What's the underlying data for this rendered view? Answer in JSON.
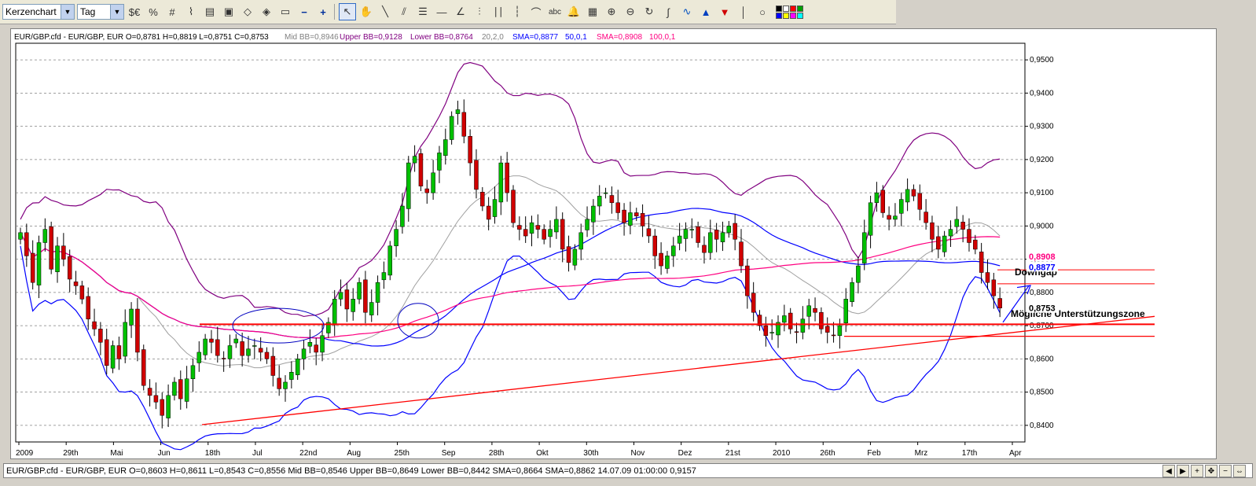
{
  "toolbar": {
    "chart_type": "Kerzenchart",
    "interval": "Tag",
    "tools": [
      "cursor",
      "hand",
      "line",
      "parallel-lines",
      "fibonacci",
      "horizontal-line",
      "fan",
      "channel",
      "cycles",
      "arc",
      "text",
      "bell",
      "calculator",
      "zoom-in",
      "zoom-out",
      "rotate",
      "wave",
      "arrow-up",
      "arrow-down",
      "vertical-line",
      "circle"
    ],
    "palette": [
      "#000000",
      "#ffffff",
      "#ff0000",
      "#00a000",
      "#0000ff",
      "#ffff00",
      "#ff00ff",
      "#00ffff"
    ]
  },
  "header": {
    "symbol": "EUR/GBP.cfd - EUR/GBP, EUR O=0,8781 H=0,8819 L=0,8751 C=0,8753",
    "mid_bb": "Mid BB=0,8946",
    "upper_bb": "Upper BB=0,9128",
    "lower_bb": "Lower BB=0,8764",
    "bb_params": "20,2,0",
    "sma50": "SMA=0,8877",
    "sma50_params": "50,0,1",
    "sma100": "SMA=0,8908",
    "sma100_params": "100,0,1"
  },
  "status": {
    "text": "EUR/GBP.cfd - EUR/GBP, EUR O=0,8603 H=0,8611 L=0,8543 C=0,8556 Mid BB=0,8546 Upper BB=0,8649 Lower BB=0,8442 SMA=0,8664 SMA=0,8862  14.07.09 01:00:00 0,9157"
  },
  "annotations": {
    "downgap": "Downgap",
    "support": "Mögliche Unterstützungszone"
  },
  "colors": {
    "bull": "#00c000",
    "bear": "#d00000",
    "bb": "#800080",
    "bb_mid": "#a0a0a0",
    "sma50": "#0000ff",
    "sma100": "#ff0080",
    "trend": "#ff0000"
  },
  "chart_data": {
    "type": "candlestick",
    "ylim": [
      0.835,
      0.955
    ],
    "yticks": [
      "0,9500",
      "0,9400",
      "0,9300",
      "0,9200",
      "0,9100",
      "0,9000",
      "0,8900",
      "0,8800",
      "0,8700",
      "0,8600",
      "0,8500",
      "0,8400"
    ],
    "xticks": [
      "2009",
      "29th",
      "Mai",
      "Jun",
      "18th",
      "Jul",
      "22nd",
      "Aug",
      "25th",
      "Sep",
      "28th",
      "Okt",
      "30th",
      "Nov",
      "Dez",
      "21st",
      "2010",
      "26th",
      "Feb",
      "Mrz",
      "17th",
      "Apr"
    ],
    "price_tags": [
      {
        "label": "0,8908",
        "value": 0.8908,
        "color": "#ff0080"
      },
      {
        "label": "0,8877",
        "value": 0.8877,
        "color": "#0000ff"
      },
      {
        "label": "0,8753",
        "value": 0.8753,
        "color": "#000000"
      }
    ],
    "close_series": [
      0.898,
      0.891,
      0.883,
      0.895,
      0.899,
      0.887,
      0.894,
      0.89,
      0.884,
      0.882,
      0.878,
      0.872,
      0.869,
      0.865,
      0.858,
      0.864,
      0.86,
      0.871,
      0.875,
      0.862,
      0.852,
      0.849,
      0.847,
      0.843,
      0.849,
      0.853,
      0.848,
      0.854,
      0.858,
      0.862,
      0.866,
      0.865,
      0.861,
      0.86,
      0.864,
      0.866,
      0.861,
      0.863,
      0.864,
      0.862,
      0.86,
      0.855,
      0.851,
      0.853,
      0.856,
      0.86,
      0.863,
      0.865,
      0.862,
      0.867,
      0.871,
      0.878,
      0.88,
      0.875,
      0.878,
      0.883,
      0.874,
      0.877,
      0.883,
      0.886,
      0.894,
      0.899,
      0.906,
      0.919,
      0.921,
      0.912,
      0.91,
      0.916,
      0.922,
      0.926,
      0.933,
      0.935,
      0.927,
      0.919,
      0.911,
      0.906,
      0.902,
      0.908,
      0.919,
      0.91,
      0.901,
      0.899,
      0.897,
      0.901,
      0.899,
      0.896,
      0.899,
      0.902,
      0.893,
      0.889,
      0.893,
      0.898,
      0.902,
      0.906,
      0.909,
      0.91,
      0.907,
      0.904,
      0.901,
      0.904,
      0.903,
      0.9,
      0.897,
      0.891,
      0.888,
      0.891,
      0.894,
      0.897,
      0.899,
      0.899,
      0.895,
      0.892,
      0.898,
      0.896,
      0.898,
      0.9,
      0.896,
      0.888,
      0.879,
      0.874,
      0.87,
      0.867,
      0.868,
      0.871,
      0.873,
      0.869,
      0.868,
      0.872,
      0.876,
      0.874,
      0.869,
      0.868,
      0.867,
      0.87,
      0.878,
      0.883,
      0.888,
      0.898,
      0.907,
      0.91,
      0.904,
      0.902,
      0.903,
      0.908,
      0.911,
      0.909,
      0.905,
      0.901,
      0.896,
      0.893,
      0.897,
      0.899,
      0.902,
      0.899,
      0.895,
      0.893,
      0.886,
      0.883,
      0.879,
      0.8753
    ]
  }
}
